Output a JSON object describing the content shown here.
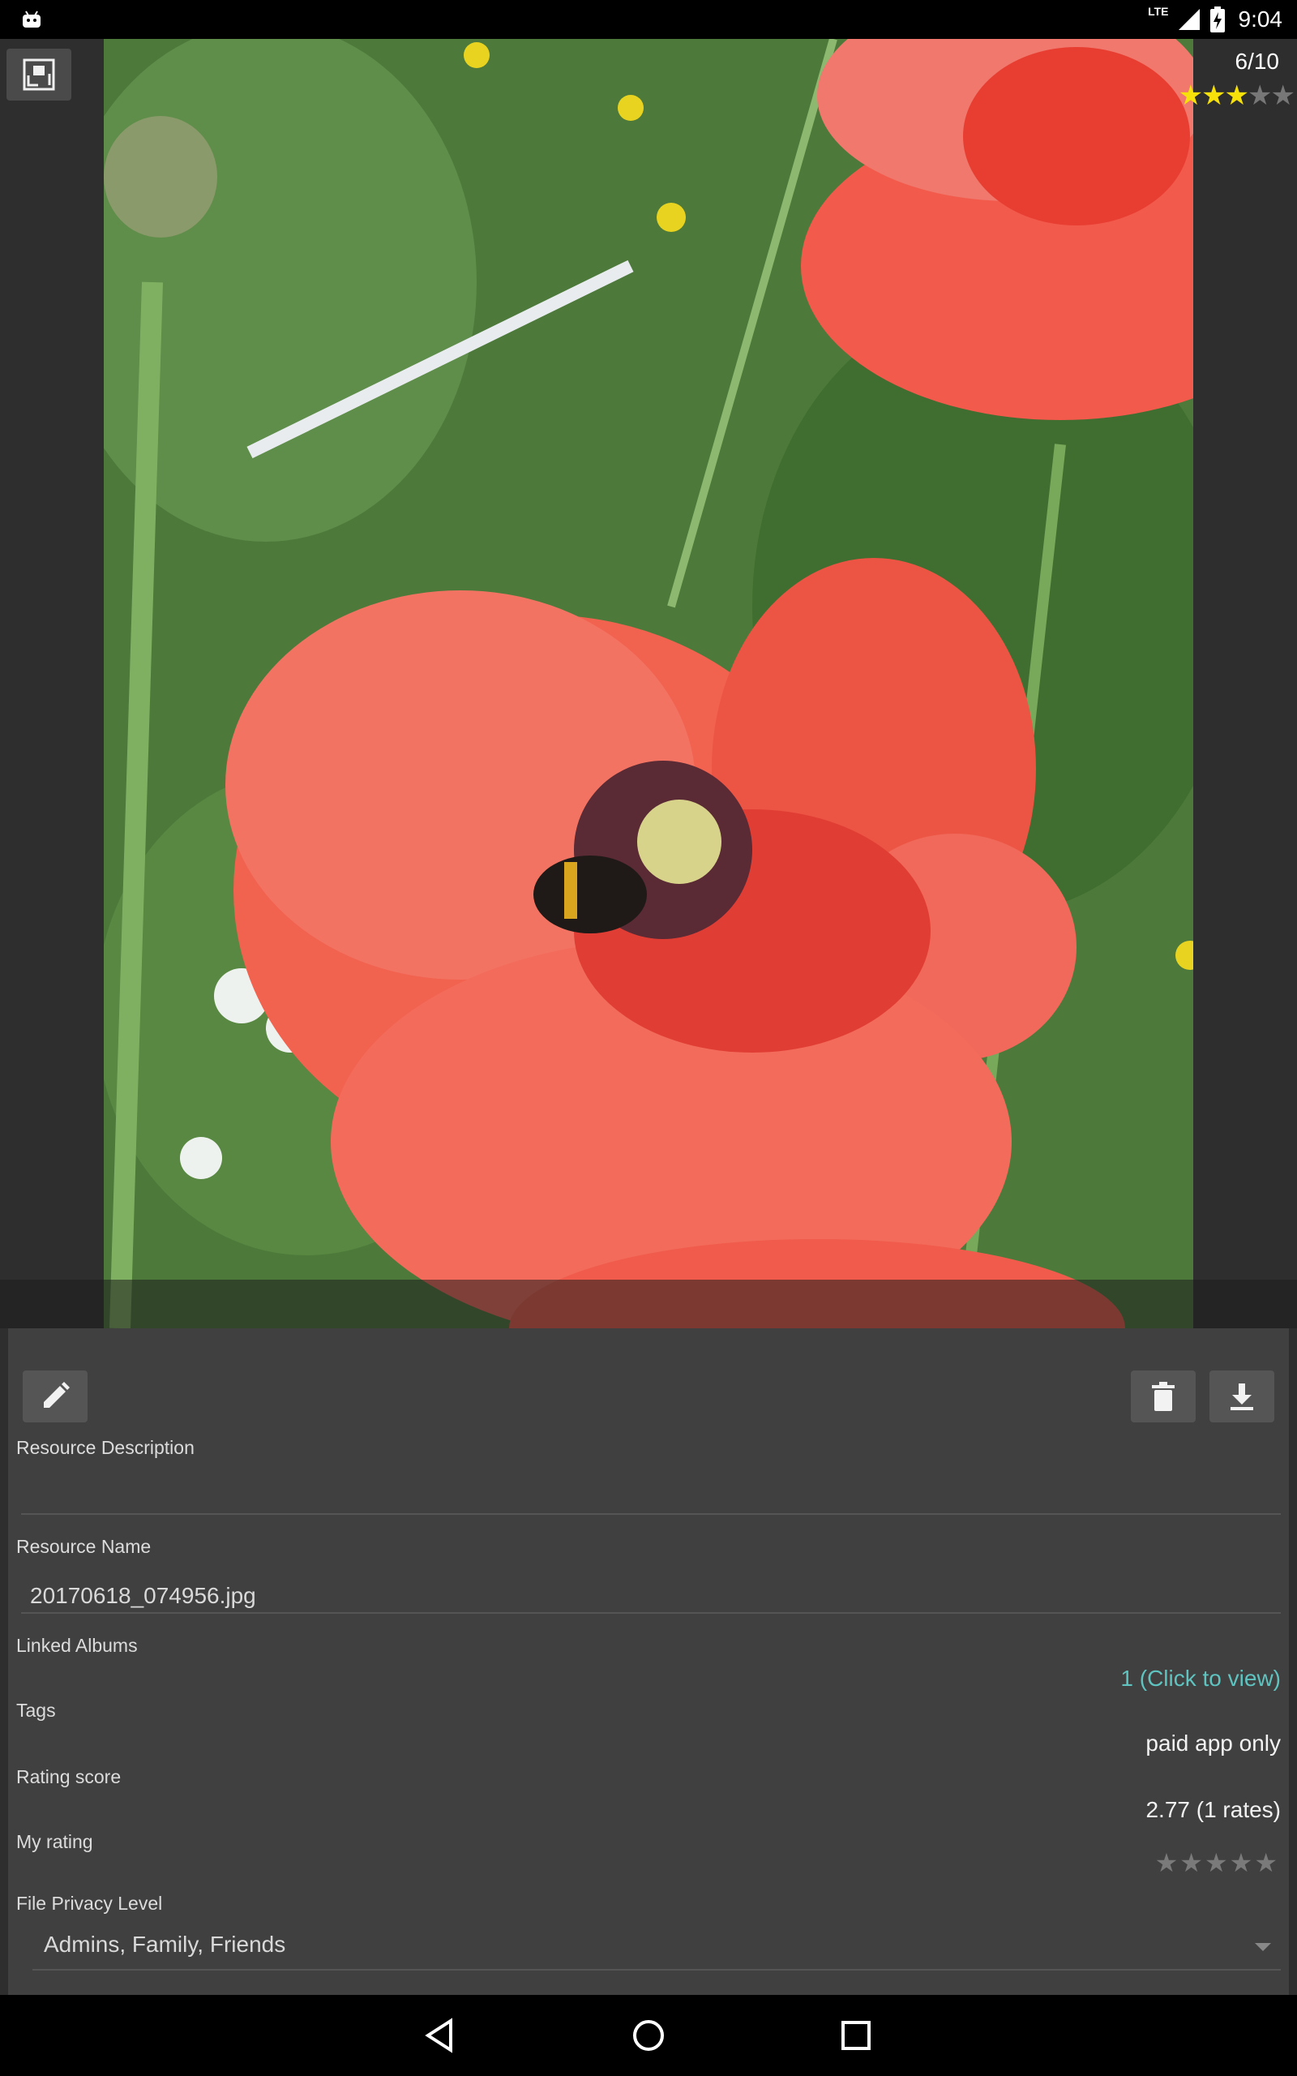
{
  "status_bar": {
    "network_label": "LTE",
    "time": "9:04"
  },
  "viewer": {
    "counter": "6/10",
    "top_rating": {
      "filled": 3,
      "total": 5
    }
  },
  "panel": {
    "description": {
      "label": "Resource Description",
      "value": ""
    },
    "name": {
      "label": "Resource Name",
      "value": "20170618_074956.jpg"
    },
    "linked_albums": {
      "label": "Linked Albums",
      "value": "1 (Click to view)"
    },
    "tags": {
      "label": "Tags",
      "value": "paid app only"
    },
    "rating_score": {
      "label": "Rating score",
      "value": "2.77 (1 rates)"
    },
    "my_rating": {
      "label": "My rating",
      "filled": 0,
      "total": 5
    },
    "privacy": {
      "label": "File Privacy Level",
      "value": "Admins, Family, Friends"
    }
  },
  "colors": {
    "accent_link": "#5fc3c0",
    "star_filled": "#f7e10a",
    "panel_bg": "#404040"
  }
}
